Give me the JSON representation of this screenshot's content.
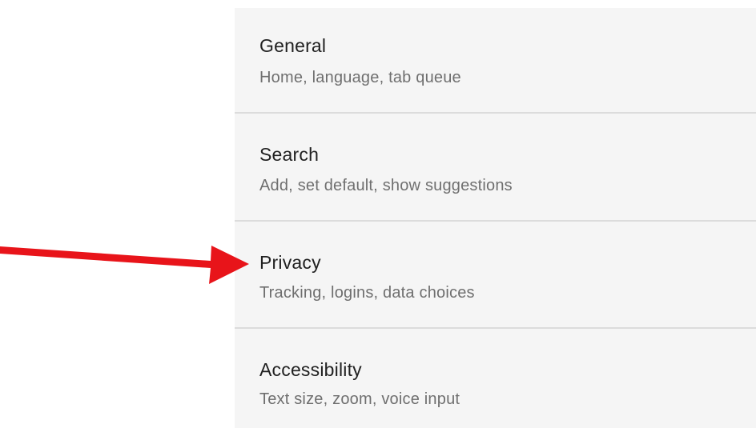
{
  "settings": {
    "items": [
      {
        "title": "General",
        "subtitle": "Home, language, tab queue"
      },
      {
        "title": "Search",
        "subtitle": "Add, set default, show suggestions"
      },
      {
        "title": "Privacy",
        "subtitle": "Tracking, logins, data choices"
      },
      {
        "title": "Accessibility",
        "subtitle": "Text size, zoom, voice input"
      }
    ]
  },
  "annotation": {
    "arrow_color": "#e8141a",
    "arrow_target": "Privacy"
  },
  "colors": {
    "panel_background": "#f5f5f5",
    "title_text": "#212121",
    "subtitle_text": "#6f6f6f",
    "divider": "#dcdcdc"
  }
}
